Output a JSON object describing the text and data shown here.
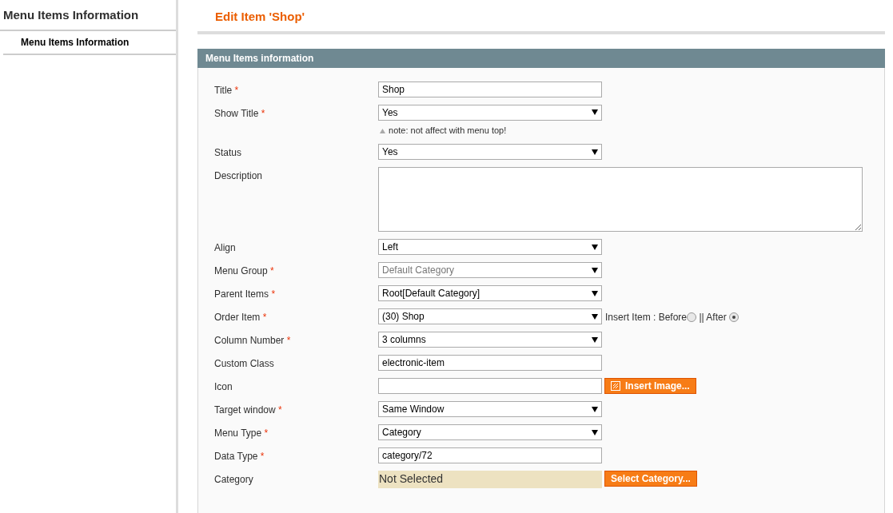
{
  "sidebar": {
    "title": "Menu Items Information",
    "items": [
      {
        "label": "Menu Items Information",
        "selected": true
      }
    ]
  },
  "page_title": "Edit Item 'Shop'",
  "panel": {
    "title": "Menu Items information",
    "fields": [
      {
        "kind": "text",
        "label": "Title",
        "required": "*",
        "value": "Shop"
      },
      {
        "kind": "select",
        "label": "Show Title",
        "required": "*",
        "value": "Yes",
        "disabled": false,
        "note": "note: not affect with menu top!"
      },
      {
        "kind": "select",
        "label": "Status",
        "value": "Yes",
        "disabled": false
      },
      {
        "kind": "textarea",
        "label": "Description"
      },
      {
        "kind": "select",
        "label": "Align",
        "value": "Left",
        "disabled": false
      },
      {
        "kind": "select",
        "label": "Menu Group",
        "required": "*",
        "value": "Default Category",
        "disabled": true
      },
      {
        "kind": "select",
        "label": "Parent Items",
        "required": "*",
        "value": "Root[Default Category]",
        "disabled": false
      },
      {
        "kind": "select",
        "label": "Order Item",
        "required": "*",
        "value": "(30) Shop",
        "disabled": false,
        "radio_label": "Insert Item :",
        "radios": [
          {
            "label": "Before",
            "selected": false
          },
          {
            "label": "|| After",
            "selected": true
          }
        ]
      },
      {
        "kind": "select",
        "label": "Column Number",
        "required": "*",
        "value": "3 columns",
        "disabled": false
      },
      {
        "kind": "text",
        "label": "Custom Class",
        "value": "electronic-item"
      },
      {
        "kind": "text",
        "label": "Icon",
        "button": "Insert Image..."
      },
      {
        "kind": "select",
        "label": "Target window",
        "required": "*",
        "value": "Same Window",
        "disabled": false
      },
      {
        "kind": "select",
        "label": "Menu Type",
        "required": "*",
        "value": "Category",
        "disabled": false
      },
      {
        "kind": "text",
        "label": "Data Type",
        "required": "*",
        "value": "category/72"
      },
      {
        "kind": "static",
        "label": "Category",
        "value": "Not Selected",
        "button": "Select Category..."
      }
    ]
  }
}
